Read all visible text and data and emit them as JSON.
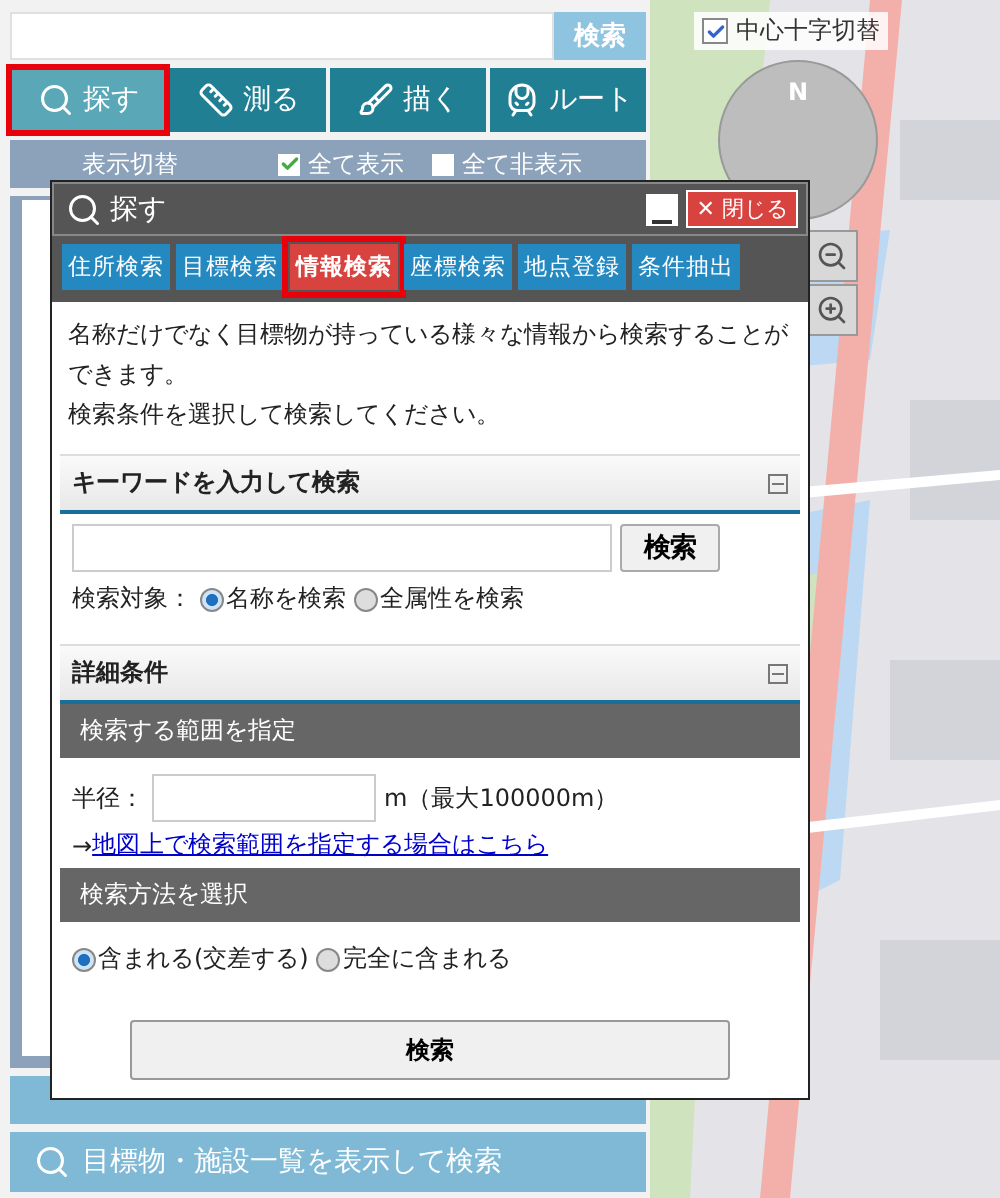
{
  "search": {
    "button": "検索"
  },
  "tools": [
    {
      "label": "探す",
      "selected": true
    },
    {
      "label": "測る",
      "selected": false
    },
    {
      "label": "描く",
      "selected": false
    },
    {
      "label": "ルート",
      "selected": false
    }
  ],
  "display_toggle": {
    "label": "表示切替",
    "options": [
      {
        "label": "全て表示",
        "checked": true
      },
      {
        "label": "全て非表示",
        "checked": false
      }
    ]
  },
  "bottom_button": {
    "label": "目標物・施設一覧を表示して検索"
  },
  "map": {
    "crosshair_toggle": {
      "label": "中心十字切替",
      "checked": true
    },
    "compass_label": "N"
  },
  "dialog": {
    "title": "探す",
    "close": "✕ 閉じる",
    "tabs": [
      {
        "label": "住所検索",
        "selected": false
      },
      {
        "label": "目標検索",
        "selected": false
      },
      {
        "label": "情報検索",
        "selected": true
      },
      {
        "label": "座標検索",
        "selected": false
      },
      {
        "label": "地点登録",
        "selected": false
      },
      {
        "label": "条件抽出",
        "selected": false
      }
    ],
    "intro": [
      "名称だけでなく目標物が持っている様々な情報から検索することができます。",
      "検索条件を選択して検索してください。"
    ],
    "keyword_section": {
      "title": "キーワードを入力して検索",
      "button": "検索",
      "target_label": "検索対象：",
      "options": [
        {
          "label": "名称を検索",
          "selected": true
        },
        {
          "label": "全属性を検索",
          "selected": false
        }
      ]
    },
    "detail_section": {
      "title": "詳細条件",
      "range_title": "検索する範囲を指定",
      "radius_label": "半径：",
      "radius_unit": "m（最大100000m）",
      "link_prefix": "→",
      "link": "地図上で検索範囲を指定する場合はこちら",
      "method_title": "検索方法を選択",
      "methods": [
        {
          "label": "含まれる(交差する)",
          "selected": true
        },
        {
          "label": "完全に含まれる",
          "selected": false
        }
      ]
    },
    "submit": "検索"
  }
}
